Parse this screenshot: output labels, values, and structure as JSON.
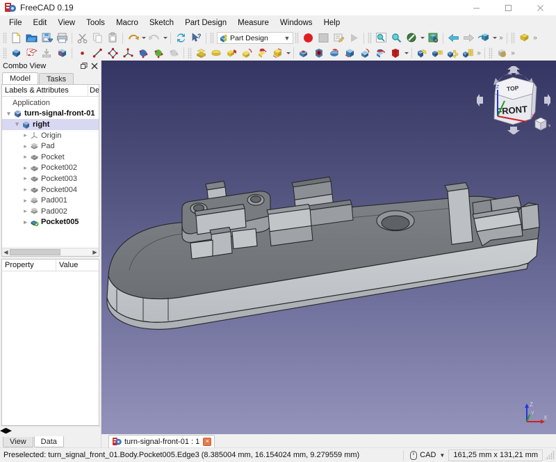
{
  "window": {
    "title": "FreeCAD 0.19",
    "app_icon": "freecad-logo-icon",
    "minimize": "minimize-icon",
    "maximize": "maximize-icon",
    "close": "close-icon"
  },
  "menubar": {
    "items": [
      {
        "label": "File"
      },
      {
        "label": "Edit"
      },
      {
        "label": "View"
      },
      {
        "label": "Tools"
      },
      {
        "label": "Macro"
      },
      {
        "label": "Sketch"
      },
      {
        "label": "Part Design"
      },
      {
        "label": "Measure"
      },
      {
        "label": "Windows"
      },
      {
        "label": "Help"
      }
    ]
  },
  "toolbar": {
    "workbench_selector": {
      "value": "Part Design",
      "icon": "part-design-workbench-icon"
    },
    "row1": [
      {
        "name": "new-document-button",
        "icon": "new-file-icon"
      },
      {
        "name": "open-document-button",
        "icon": "open-folder-icon"
      },
      {
        "name": "save-document-button",
        "icon": "save-icon"
      },
      {
        "name": "print-button",
        "icon": "printer-icon"
      },
      {
        "name": "cut-button",
        "icon": "scissors-icon"
      },
      {
        "name": "copy-button",
        "icon": "copy-icon"
      },
      {
        "name": "paste-button",
        "icon": "clipboard-icon"
      },
      {
        "name": "undo-button",
        "icon": "undo-arrow-icon"
      },
      {
        "name": "redo-button",
        "icon": "redo-arrow-icon"
      },
      {
        "name": "refresh-button",
        "icon": "refresh-icon"
      },
      {
        "name": "whats-this-button",
        "icon": "cursor-question-icon"
      },
      {
        "name": "create-body-button",
        "icon": "red-sphere-icon"
      },
      {
        "name": "create-sketch-button",
        "icon": "grey-square-icon"
      },
      {
        "name": "edit-sketch-button",
        "icon": "notepad-pencil-icon"
      },
      {
        "name": "validate-sketch-button",
        "icon": "play-triangle-icon"
      },
      {
        "name": "fit-all-button",
        "icon": "zoom-fit-icon"
      },
      {
        "name": "zoom-button",
        "icon": "magnifier-icon"
      },
      {
        "name": "draw-style-button",
        "icon": "no-entry-icon"
      },
      {
        "name": "axonometric-view-button",
        "icon": "axonometric-cube-icon"
      },
      {
        "name": "previous-view-button",
        "icon": "left-arrow-icon"
      },
      {
        "name": "next-view-button",
        "icon": "right-arrow-icon"
      },
      {
        "name": "view-section-button",
        "icon": "section-cube-icon"
      },
      {
        "name": "measure-button",
        "icon": "yellow-block-icon"
      }
    ],
    "row2": [
      {
        "name": "part-design-body-button",
        "icon": "blue-body-icon"
      },
      {
        "name": "create-sketch2-button",
        "icon": "red-sketch-icon"
      },
      {
        "name": "attach-sketch-button",
        "icon": "attach-icon"
      },
      {
        "name": "map-sketch-button",
        "icon": "map-sketch-icon"
      },
      {
        "name": "create-point-button",
        "icon": "point-icon"
      },
      {
        "name": "create-line-button",
        "icon": "line-icon"
      },
      {
        "name": "create-polyline-button",
        "icon": "polyline-icon"
      },
      {
        "name": "create-datum-button",
        "icon": "datum-axis-icon"
      },
      {
        "name": "create-shape-blue-button",
        "icon": "blue-shape-icon"
      },
      {
        "name": "create-shape-green-button",
        "icon": "green-shape-icon"
      },
      {
        "name": "create-shape-grey-button",
        "icon": "grey-shape-icon"
      },
      {
        "name": "pad-button",
        "icon": "pad-icon"
      },
      {
        "name": "revolution-button",
        "icon": "revolution-icon"
      },
      {
        "name": "additive-loft-button",
        "icon": "additive-loft-icon"
      },
      {
        "name": "additive-pipe-button",
        "icon": "additive-pipe-icon"
      },
      {
        "name": "additive-helix-button",
        "icon": "additive-helix-icon"
      },
      {
        "name": "additive-box-button",
        "icon": "additive-box-icon"
      },
      {
        "name": "pocket-button",
        "icon": "pocket-icon"
      },
      {
        "name": "hole-button",
        "icon": "hole-icon"
      },
      {
        "name": "groove-button",
        "icon": "groove-icon"
      },
      {
        "name": "subtractive-loft-button",
        "icon": "subtractive-loft-icon"
      },
      {
        "name": "subtractive-pipe-button",
        "icon": "subtractive-pipe-icon"
      },
      {
        "name": "subtractive-helix-button",
        "icon": "subtractive-helix-icon"
      },
      {
        "name": "subtractive-box-button",
        "icon": "subtractive-box-icon"
      },
      {
        "name": "mirrored-button",
        "icon": "mirrored-icon"
      },
      {
        "name": "linear-pattern-button",
        "icon": "linear-pattern-icon"
      },
      {
        "name": "polar-pattern-button",
        "icon": "polar-pattern-icon"
      },
      {
        "name": "multi-transform-button",
        "icon": "multi-transform-icon"
      },
      {
        "name": "boolean-button",
        "icon": "boolean-icon"
      }
    ]
  },
  "combo_view": {
    "title": "Combo View",
    "float_icon": "float-window-icon",
    "close_icon": "close-icon",
    "tabs": [
      {
        "label": "Model",
        "active": true
      },
      {
        "label": "Tasks",
        "active": false
      }
    ],
    "tree_headers": {
      "labels": "Labels & Attributes",
      "description": "De"
    },
    "tree": [
      {
        "label": "Application",
        "indent": 0,
        "arrow": "",
        "icon": "",
        "bold": false,
        "selected": false
      },
      {
        "label": "turn-signal-front-01",
        "indent": 1,
        "arrow": "v",
        "icon": "document-icon",
        "bold": true,
        "selected": false
      },
      {
        "label": "right",
        "indent": 2,
        "arrow": "v",
        "icon": "body-icon",
        "bold": true,
        "selected": true
      },
      {
        "label": "Origin",
        "indent": 3,
        "arrow": ">",
        "icon": "origin-icon",
        "bold": false,
        "selected": false
      },
      {
        "label": "Pad",
        "indent": 3,
        "arrow": ">",
        "icon": "pad-feature-icon",
        "bold": false,
        "selected": false
      },
      {
        "label": "Pocket",
        "indent": 3,
        "arrow": ">",
        "icon": "pocket-feature-icon",
        "bold": false,
        "selected": false
      },
      {
        "label": "Pocket002",
        "indent": 3,
        "arrow": ">",
        "icon": "pocket-feature-icon",
        "bold": false,
        "selected": false
      },
      {
        "label": "Pocket003",
        "indent": 3,
        "arrow": ">",
        "icon": "pocket-feature-icon",
        "bold": false,
        "selected": false
      },
      {
        "label": "Pocket004",
        "indent": 3,
        "arrow": ">",
        "icon": "pocket-feature-icon",
        "bold": false,
        "selected": false
      },
      {
        "label": "Pad001",
        "indent": 3,
        "arrow": ">",
        "icon": "pad-feature-icon",
        "bold": false,
        "selected": false
      },
      {
        "label": "Pad002",
        "indent": 3,
        "arrow": ">",
        "icon": "pad-feature-icon",
        "bold": false,
        "selected": false
      },
      {
        "label": "Pocket005",
        "indent": 3,
        "arrow": ">",
        "icon": "tip-feature-icon",
        "bold": true,
        "selected": false
      }
    ],
    "property_headers": {
      "property": "Property",
      "value": "Value"
    },
    "property_rows": [],
    "bottom_tabs": [
      {
        "label": "View",
        "active": false
      },
      {
        "label": "Data",
        "active": true
      }
    ]
  },
  "view3d": {
    "navigation_cube": {
      "top_face": "TOP",
      "front_face": "FRONT",
      "arrow_up": "nav-arrow-up-icon",
      "arrow_down": "nav-arrow-down-icon",
      "arrow_left": "nav-arrow-left-icon",
      "arrow_right": "nav-arrow-right-icon"
    },
    "axis_labels": {
      "x": "X",
      "y": "Y",
      "z": "Z"
    },
    "axis_colors": {
      "x": "#d02020",
      "y": "#18a018",
      "z": "#2030d0"
    },
    "background": {
      "top": "#353563",
      "bottom": "#9393bb"
    },
    "model_colors": {
      "top_face": "#73777c",
      "side_face": "#c3c5c8",
      "edge": "#2a2a2a"
    }
  },
  "document_tabs": [
    {
      "label": "turn-signal-front-01 : 1",
      "icon": "freecad-document-icon",
      "close": "×",
      "active": true
    }
  ],
  "statusbar": {
    "message": "Preselected: turn_signal_front_01.Body.Pocket005.Edge3 (8.385004 mm, 16.154024 mm, 9.279559 mm)",
    "navigation_mode": "CAD",
    "navigation_icon": "mouse-icon",
    "dimensions": "161,25 mm x 131,21 mm",
    "resize_grip": "resize-grip-icon"
  }
}
